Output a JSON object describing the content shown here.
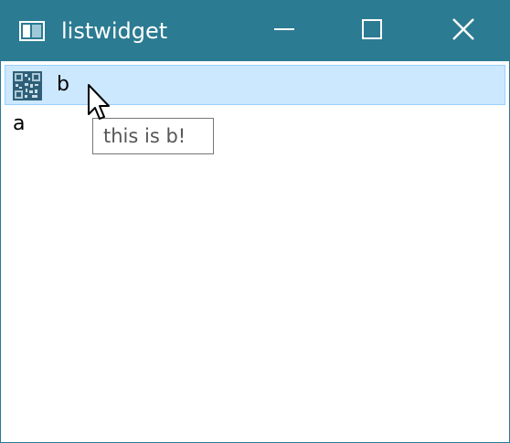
{
  "window": {
    "title": "listwidget",
    "icon": "app-window-icon",
    "controls": {
      "minimize_icon": "minimize-icon",
      "maximize_icon": "maximize-icon",
      "close_icon": "close-icon"
    }
  },
  "list": {
    "items": [
      {
        "label": "b",
        "icon": "qr-code-icon",
        "selected": true
      },
      {
        "label": "a",
        "selected": false
      }
    ]
  },
  "tooltip": {
    "text": "this is b!"
  },
  "colors": {
    "titlebar": "#2b7b92",
    "selection_fill": "#cce8ff",
    "selection_border": "#99d1ff",
    "tooltip_border": "#767676",
    "tooltip_text": "#575757"
  }
}
